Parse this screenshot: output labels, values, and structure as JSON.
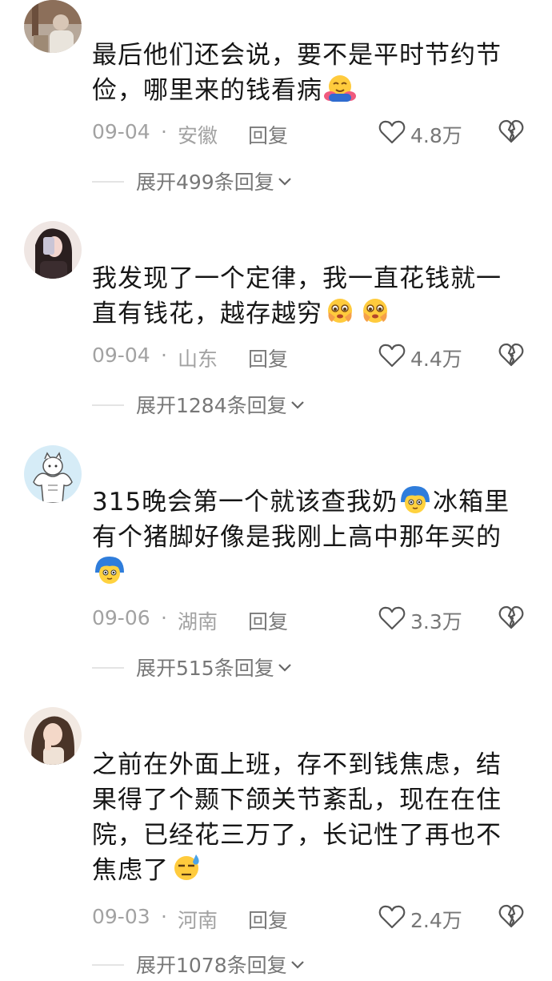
{
  "comments": [
    {
      "avatar_icon": "user-avatar-photo",
      "text_lines": [
        "最后他们还会说，要不是平时节约节",
        "俭，哪里来的钱看病"
      ],
      "emojis": [
        "hug-emoji"
      ],
      "date": "09-04",
      "separator": "·",
      "location": "安徽",
      "reply_label": "回复",
      "likes": "4.8万",
      "expand_label": "展开499条回复"
    },
    {
      "avatar_icon": "user-avatar-photo",
      "text_lines": [
        "我发现了一个定律，我一直花钱就一",
        "直有钱花，越存越穷"
      ],
      "emojis": [
        "crying-emoji",
        "crying-emoji"
      ],
      "date": "09-04",
      "separator": "·",
      "location": "山东",
      "reply_label": "回复",
      "likes": "4.4万",
      "expand_label": "展开1284条回复"
    },
    {
      "avatar_icon": "muscle-cat-avatar",
      "text_lines": [
        "315晚会第一个就该查我奶",
        "冰箱里",
        "有个猪脚好像是我刚上高中那年买的"
      ],
      "emojis": [
        "blue-hair-face-emoji",
        "blue-hair-face-emoji"
      ],
      "date": "09-06",
      "separator": "·",
      "location": "湖南",
      "reply_label": "回复",
      "likes": "3.3万",
      "expand_label": "展开515条回复"
    },
    {
      "avatar_icon": "user-avatar-photo",
      "text_lines": [
        "之前在外面上班，存不到钱焦虑，结",
        "果得了个颞下颌关节紊乱，现在在住",
        "院，已经花三万了，长记性了再也不",
        "焦虑了"
      ],
      "emojis": [
        "sweat-face-emoji"
      ],
      "date": "09-03",
      "separator": "·",
      "location": "河南",
      "reply_label": "回复",
      "likes": "2.4万",
      "expand_label": "展开1078条回复"
    }
  ],
  "icons": {
    "like": "heart-outline-icon",
    "dislike": "broken-heart-icon",
    "expand": "chevron-down-icon"
  },
  "colors": {
    "text": "#161616",
    "meta": "#a2a2a2",
    "action": "#777777"
  }
}
